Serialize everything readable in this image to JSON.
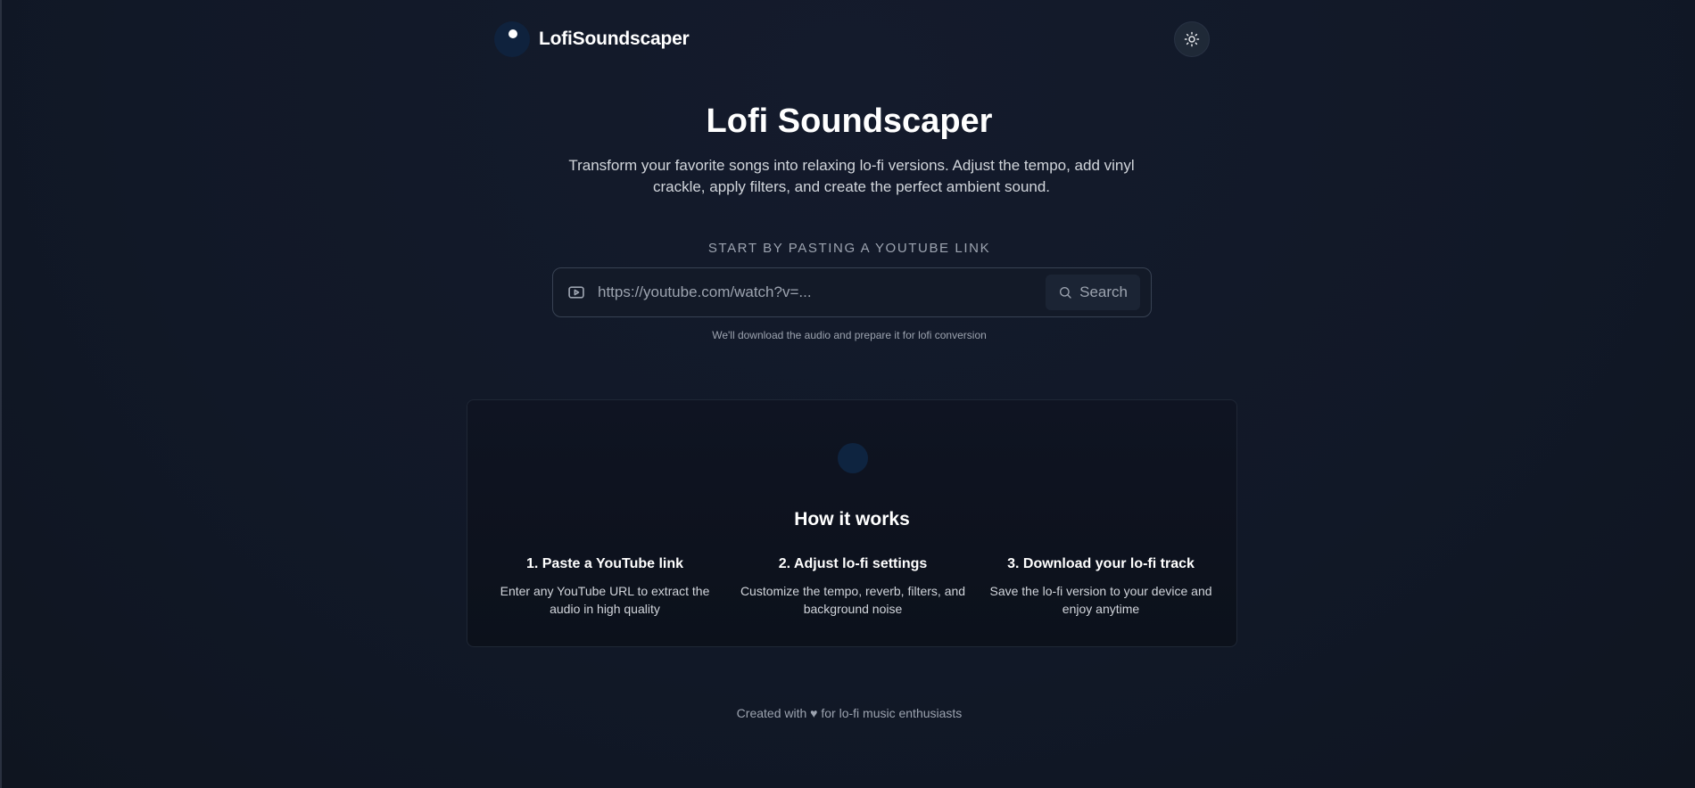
{
  "header": {
    "brand_name": "LofiSoundscaper",
    "logo_icon": "record-dot-icon",
    "theme_toggle_icon": "sun-icon"
  },
  "hero": {
    "title": "Lofi Soundscaper",
    "subtitle": "Transform your favorite songs into relaxing lo-fi versions. Adjust the tempo, add vinyl crackle, apply filters, and create the perfect ambient sound."
  },
  "search": {
    "label": "START BY PASTING A YOUTUBE LINK",
    "placeholder": "https://youtube.com/watch?v=...",
    "value": "",
    "button_label": "Search",
    "hint": "We'll download the audio and prepare it for lofi conversion"
  },
  "how_it_works": {
    "title": "How it works",
    "steps": [
      {
        "title": "1. Paste a YouTube link",
        "desc": "Enter any YouTube URL to extract the audio in high quality"
      },
      {
        "title": "2. Adjust lo-fi settings",
        "desc": "Customize the tempo, reverb, filters, and background noise"
      },
      {
        "title": "3. Download your lo-fi track",
        "desc": "Save the lo-fi version to your device and enjoy anytime"
      }
    ]
  },
  "footer": {
    "text": "Created with ♥ for lo-fi music enthusiasts"
  },
  "colors": {
    "background": "#111827",
    "accent_dark_blue": "#0f223d",
    "text_primary": "#ffffff",
    "text_muted": "#9ca3af"
  }
}
